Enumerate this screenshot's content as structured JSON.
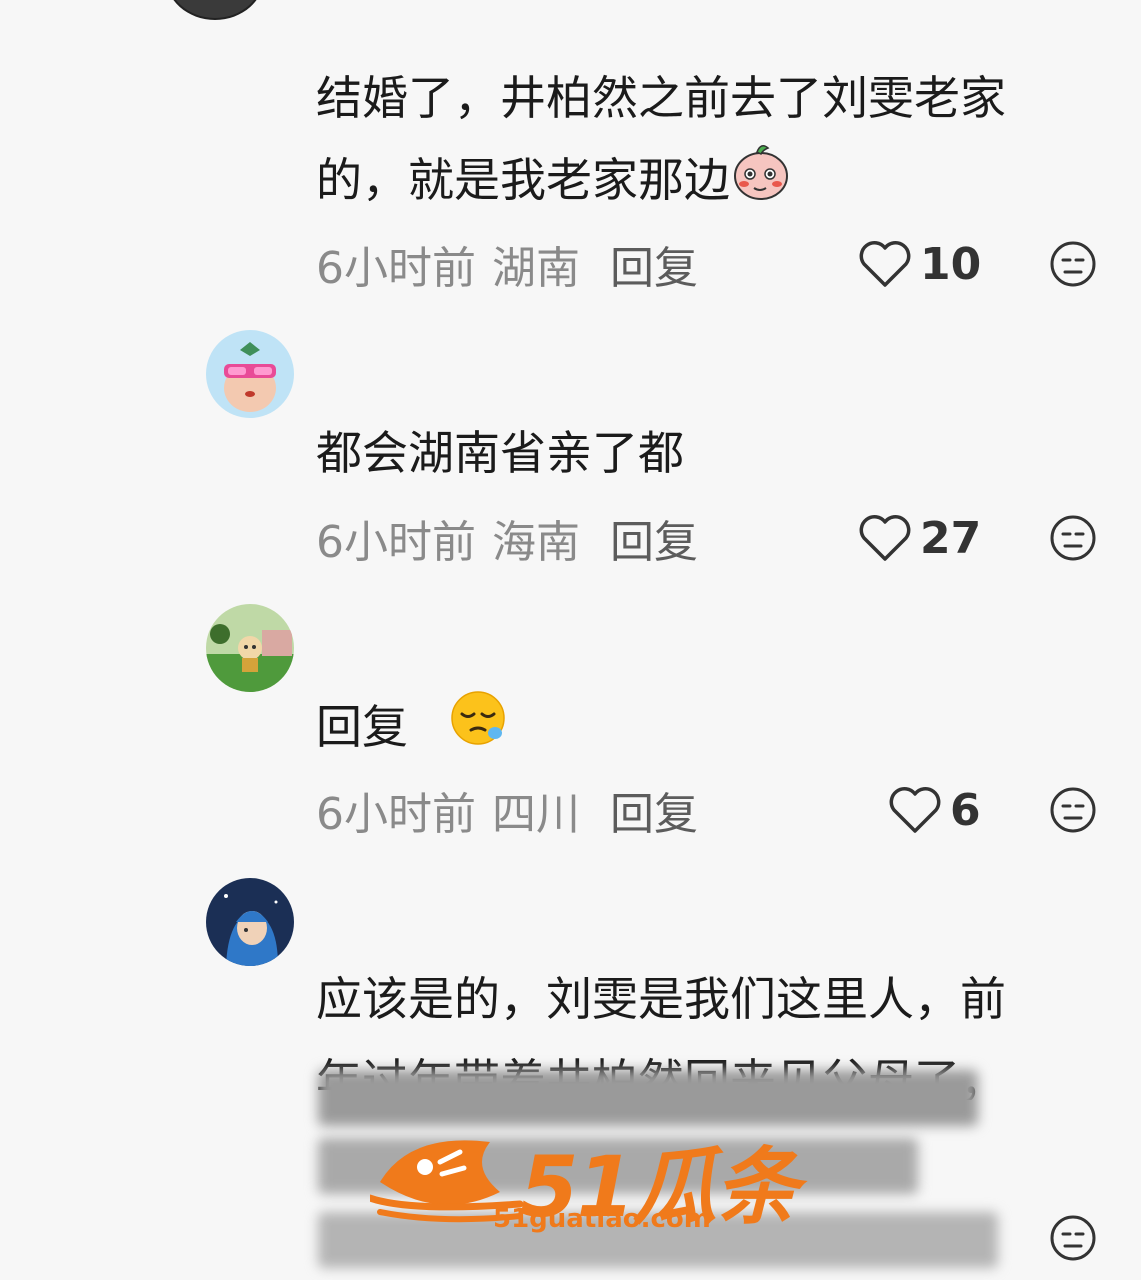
{
  "comments": [
    {
      "text_lines": [
        "结婚了，井柏然之前去了刘雯老家",
        "的，就是我老家那边"
      ],
      "time": "6小时前",
      "region": "湖南",
      "reply": "回复",
      "likes": "10"
    },
    {
      "text": "都会湖南省亲了都",
      "time": "6小时前",
      "region": "海南",
      "reply": "回复",
      "likes": "27"
    },
    {
      "text": "回复",
      "time": "6小时前",
      "region": "四川",
      "reply": "回复",
      "likes": "6"
    },
    {
      "text_lines": [
        "应该是的，刘雯是我们这里人，前",
        "年过年带着井柏然回来见父母了，"
      ]
    }
  ],
  "watermark": {
    "brand": "51瓜条",
    "url": "51guatiao.com"
  },
  "colors": {
    "background": "#f7f7f7",
    "meta_text": "#8a8a8a",
    "watermark": "#f07a1b"
  }
}
